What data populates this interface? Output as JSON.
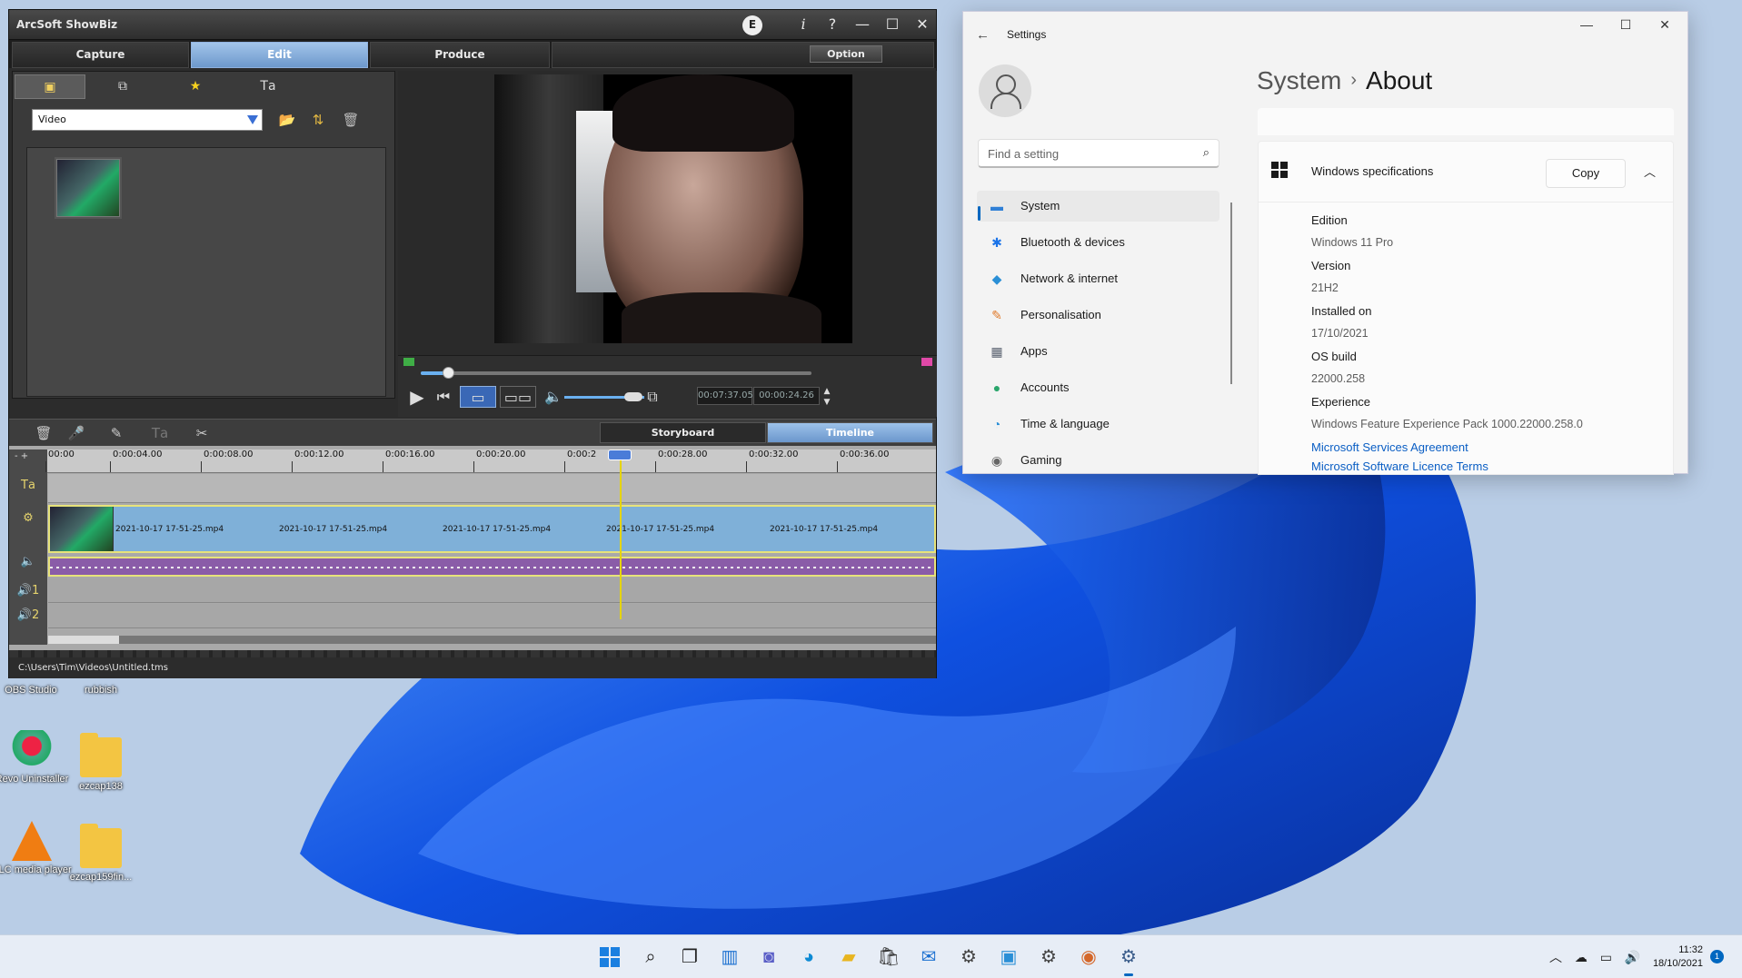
{
  "colors": {
    "wall_bg": "#b7cce6",
    "wall_blue": "#0d47d6",
    "accent": "#0067c0",
    "showbiz_tab_active": "#7aa6d8",
    "timeline_video": "#7fb0d8",
    "timeline_audio": "#8a5ca8",
    "link": "#0a5ec4"
  },
  "showbiz": {
    "title": "ArcSoft ShowBiz",
    "title_controls": {
      "e_label": "E",
      "info": "i",
      "help": "?",
      "minimize": "—",
      "maximize": "☐",
      "close": "✕"
    },
    "tabs": [
      {
        "label": "Capture",
        "active": false
      },
      {
        "label": "Edit",
        "active": true
      },
      {
        "label": "Produce",
        "active": false
      }
    ],
    "option_label": "Option",
    "library": {
      "tab_icons": [
        "video-library-icon",
        "transitions-icon",
        "effects-icon",
        "text-icon"
      ],
      "media_type": "Video",
      "tool_icons": [
        "import-folder-icon",
        "sort-icon",
        "delete-icon"
      ],
      "clip_name": "2021-10-17 17-51-25.mp4"
    },
    "player": {
      "progress": 0.07,
      "time_current": "00:07:37.05",
      "time_total": "00:00:24.26",
      "volume_level": 0.8,
      "icons": [
        "play-icon",
        "skip-to-start-icon",
        "storyboard-mode-icon",
        "timeline-mode-icon",
        "volume-icon",
        "fullscreen-icon",
        "timecode-spinner-icon"
      ]
    },
    "timeline_tools": [
      "delete-clip-icon",
      "narration-mic-icon",
      "edit-clip-icon",
      "text-tool-icon",
      "split-icon"
    ],
    "views": {
      "storyboard": "Storyboard",
      "timeline": "Timeline",
      "active": "Timeline"
    },
    "ruler": [
      "00:00",
      "0:00:04.00",
      "0:00:08.00",
      "0:00:12.00",
      "0:00:16.00",
      "0:00:20.00",
      "0:00:2",
      "0:00:28.00",
      "0:00:32.00",
      "0:00:36.00"
    ],
    "ruler_leading": "- +",
    "track_labels": {
      "text": "Tа",
      "effects": "⚙",
      "audio": "🔈",
      "narr1": "🔊1",
      "narr2": "🔊2"
    },
    "video_clip_labels": [
      "2021-10-17 17-51-25.mp4",
      "2021-10-17 17-51-25.mp4",
      "2021-10-17 17-51-25.mp4",
      "2021-10-17 17-51-25.mp4",
      "2021-10-17 17-51-25.mp4"
    ],
    "status_path": "C:\\Users\\Tim\\Videos\\Untitled.tms"
  },
  "settings": {
    "app_title": "Settings",
    "window_controls": {
      "minimize": "—",
      "maximize": "☐",
      "close": "✕"
    },
    "search_placeholder": "Find a setting",
    "nav": [
      {
        "label": "System",
        "icon": "system-icon",
        "selected": true
      },
      {
        "label": "Bluetooth & devices",
        "icon": "bluetooth-icon",
        "selected": false
      },
      {
        "label": "Network & internet",
        "icon": "wifi-icon",
        "selected": false
      },
      {
        "label": "Personalisation",
        "icon": "brush-icon",
        "selected": false
      },
      {
        "label": "Apps",
        "icon": "apps-icon",
        "selected": false
      },
      {
        "label": "Accounts",
        "icon": "account-icon",
        "selected": false
      },
      {
        "label": "Time & language",
        "icon": "globe-clock-icon",
        "selected": false
      },
      {
        "label": "Gaming",
        "icon": "gamepad-icon",
        "selected": false
      }
    ],
    "breadcrumb": {
      "parent": "System",
      "separator": "›",
      "current": "About"
    },
    "spec_title": "Windows specifications",
    "copy_label": "Copy",
    "specs": [
      {
        "label": "Edition",
        "value": "Windows 11 Pro"
      },
      {
        "label": "Version",
        "value": "21H2"
      },
      {
        "label": "Installed on",
        "value": "17/10/2021"
      },
      {
        "label": "OS build",
        "value": "22000.258"
      },
      {
        "label": "Experience",
        "value": "Windows Feature Experience Pack 1000.22000.258.0"
      }
    ],
    "links": [
      "Microsoft Services Agreement",
      "Microsoft Software Licence Terms"
    ]
  },
  "desktop": {
    "icons": [
      {
        "label": "OBS Studio",
        "kind": "obs-icon"
      },
      {
        "label": "rubbish",
        "kind": "folder-icon"
      },
      {
        "label": "Revo Uninstaller",
        "kind": "revo-icon"
      },
      {
        "label": "ezcap138",
        "kind": "folder-icon"
      },
      {
        "label": "VLC media player",
        "kind": "vlc-icon"
      },
      {
        "label": "ezcap159fin...",
        "kind": "folder-icon"
      }
    ]
  },
  "taskbar": {
    "apps": [
      "start-icon",
      "search-icon",
      "task-view-icon",
      "widgets-icon",
      "chat-icon",
      "edge-icon",
      "file-explorer-icon",
      "store-icon",
      "mail-icon",
      "app1-icon",
      "app2-icon",
      "app3-icon",
      "browser-icon",
      "settings-icon"
    ],
    "time": "11:32",
    "date": "18/10/2021",
    "notification_count": "1",
    "tray_icons": [
      "chevron-up-icon",
      "onedrive-icon",
      "network-icon",
      "volume-icon"
    ]
  }
}
